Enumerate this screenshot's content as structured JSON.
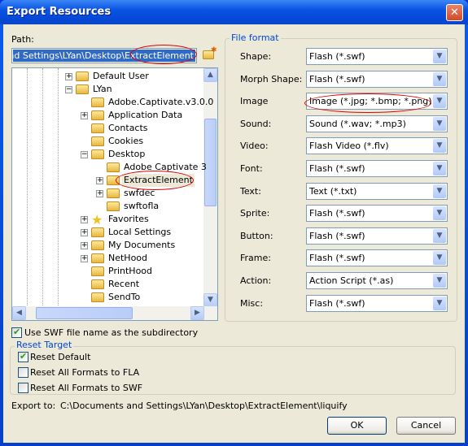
{
  "window": {
    "title": "Export Resources",
    "close_icon": "close-icon"
  },
  "path": {
    "label": "Path:",
    "value": "ts and Settings\\LYan\\Desktop\\ExtractElement",
    "browse_icon": "folder-browse-icon"
  },
  "tree": {
    "items": [
      {
        "label": "Default User",
        "level": 0,
        "expander": "+",
        "icon": "folder"
      },
      {
        "label": "LYan",
        "level": 0,
        "expander": "-",
        "icon": "folder"
      },
      {
        "label": "Adobe.Captivate.v3.0.0",
        "level": 1,
        "expander": "",
        "icon": "folder"
      },
      {
        "label": "Application Data",
        "level": 1,
        "expander": "+",
        "icon": "folder"
      },
      {
        "label": "Contacts",
        "level": 1,
        "expander": "",
        "icon": "folder"
      },
      {
        "label": "Cookies",
        "level": 1,
        "expander": "",
        "icon": "folder"
      },
      {
        "label": "Desktop",
        "level": 1,
        "expander": "-",
        "icon": "folder"
      },
      {
        "label": "Adobe Captivate 3",
        "level": 2,
        "expander": "",
        "icon": "folder"
      },
      {
        "label": "ExtractElement",
        "level": 2,
        "expander": "+",
        "icon": "folder",
        "selected": true
      },
      {
        "label": "swfdec",
        "level": 2,
        "expander": "+",
        "icon": "folder"
      },
      {
        "label": "swftofla",
        "level": 2,
        "expander": "",
        "icon": "folder"
      },
      {
        "label": "Favorites",
        "level": 1,
        "expander": "+",
        "icon": "star"
      },
      {
        "label": "Local Settings",
        "level": 1,
        "expander": "+",
        "icon": "folder"
      },
      {
        "label": "My Documents",
        "level": 1,
        "expander": "+",
        "icon": "folder"
      },
      {
        "label": "NetHood",
        "level": 1,
        "expander": "+",
        "icon": "folder"
      },
      {
        "label": "PrintHood",
        "level": 1,
        "expander": "",
        "icon": "folder"
      },
      {
        "label": "Recent",
        "level": 1,
        "expander": "",
        "icon": "folder"
      },
      {
        "label": "SendTo",
        "level": 1,
        "expander": "",
        "icon": "folder"
      }
    ]
  },
  "file_format": {
    "title": "File format",
    "rows": [
      {
        "label": "Shape:",
        "value": "Flash (*.swf)"
      },
      {
        "label": "Morph Shape:",
        "value": "Flash (*.swf)"
      },
      {
        "label": "Image",
        "value": "Image (*.jpg; *.bmp; *.png)"
      },
      {
        "label": "Sound:",
        "value": "Sound (*.wav; *.mp3)"
      },
      {
        "label": "Video:",
        "value": "Flash Video (*.flv)"
      },
      {
        "label": "Font:",
        "value": "Flash (*.swf)"
      },
      {
        "label": "Text:",
        "value": "Text (*.txt)"
      },
      {
        "label": "Sprite:",
        "value": "Flash (*.swf)"
      },
      {
        "label": "Button:",
        "value": "Flash (*.swf)"
      },
      {
        "label": "Frame:",
        "value": "Flash (*.swf)"
      },
      {
        "label": "Action:",
        "value": "Action Script (*.as)"
      },
      {
        "label": "Misc:",
        "value": "Flash (*.swf)"
      }
    ]
  },
  "use_swf": {
    "label": "Use SWF file name as the subdirectory",
    "checked": true
  },
  "reset_target": {
    "title": "Reset Target",
    "options": [
      {
        "label": "Reset Default",
        "checked": true
      },
      {
        "label": "Reset All Formats to FLA",
        "checked": false
      },
      {
        "label": "Reset All Formats to SWF",
        "checked": false
      }
    ]
  },
  "export": {
    "label": "Export to:",
    "value": "C:\\Documents and Settings\\LYan\\Desktop\\ExtractElement\\liquify"
  },
  "buttons": {
    "ok": "OK",
    "cancel": "Cancel"
  },
  "colors": {
    "title_bar": "#0a54e3",
    "dialog_bg": "#ece9d8",
    "selection": "#316ac5",
    "group_title": "#0046d5",
    "annotation": "#e00000"
  }
}
